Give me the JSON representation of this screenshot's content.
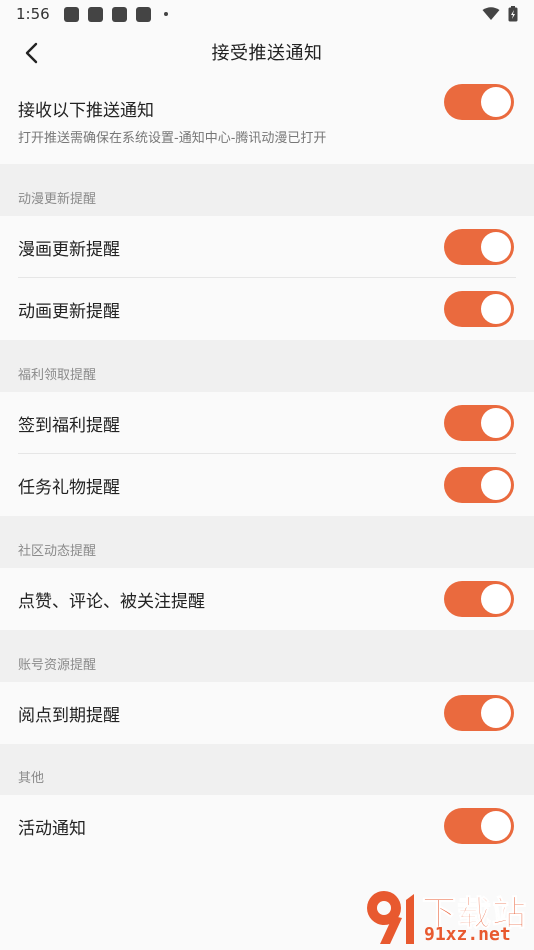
{
  "status_bar": {
    "time": "1:56"
  },
  "header": {
    "title": "接受推送通知",
    "back_icon": "chevron-left-icon"
  },
  "main_toggle": {
    "label": "接收以下推送通知",
    "description": "打开推送需确保在系统设置-通知中心-腾讯动漫已打开",
    "on": true
  },
  "sections": [
    {
      "title": "动漫更新提醒",
      "items": [
        {
          "label": "漫画更新提醒",
          "on": true
        },
        {
          "label": "动画更新提醒",
          "on": true
        }
      ]
    },
    {
      "title": "福利领取提醒",
      "items": [
        {
          "label": "签到福利提醒",
          "on": true
        },
        {
          "label": "任务礼物提醒",
          "on": true
        }
      ]
    },
    {
      "title": "社区动态提醒",
      "items": [
        {
          "label": "点赞、评论、被关注提醒",
          "on": true
        }
      ]
    },
    {
      "title": "账号资源提醒",
      "items": [
        {
          "label": "阅点到期提醒",
          "on": true
        }
      ]
    },
    {
      "title": "其他",
      "items": [
        {
          "label": "活动通知",
          "on": true
        }
      ]
    }
  ],
  "watermark": {
    "title": "下载站",
    "url": "91xz.net"
  },
  "colors": {
    "toggle_on": "#ea6a3e",
    "page_background": "#f0f0f0",
    "card_background": "#fafafa"
  }
}
